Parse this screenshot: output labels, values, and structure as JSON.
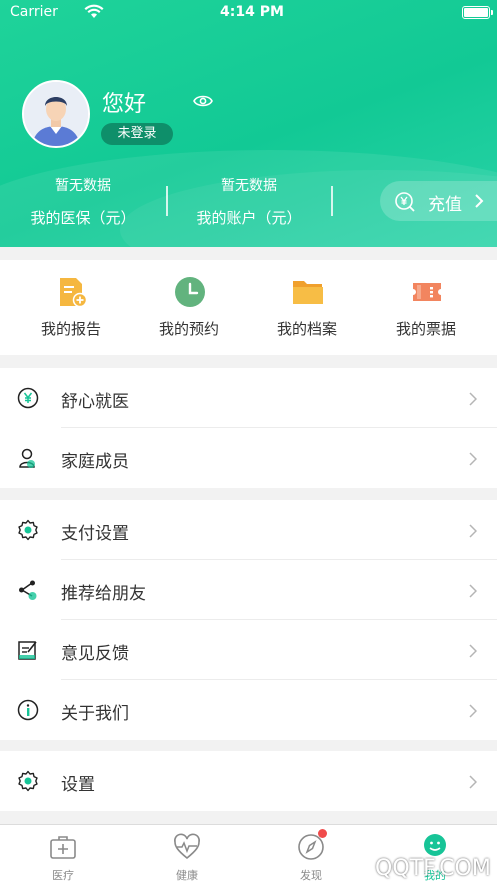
{
  "status_bar": {
    "carrier": "Carrier",
    "time": "4:14 PM"
  },
  "profile": {
    "greeting": "您好",
    "login_status": "未登录"
  },
  "stats": [
    {
      "value": "暂无数据",
      "label": "我的医保（元）"
    },
    {
      "value": "暂无数据",
      "label": "我的账户（元）"
    }
  ],
  "recharge": {
    "label": "充值"
  },
  "quick_actions": [
    {
      "label": "我的报告",
      "icon": "report-icon"
    },
    {
      "label": "我的预约",
      "icon": "clock-icon"
    },
    {
      "label": "我的档案",
      "icon": "folder-icon"
    },
    {
      "label": "我的票据",
      "icon": "ticket-icon"
    }
  ],
  "menu_group_1": [
    {
      "label": "舒心就医",
      "icon": "yen-circle-icon"
    },
    {
      "label": "家庭成员",
      "icon": "family-member-icon"
    }
  ],
  "menu_group_2": [
    {
      "label": "支付设置",
      "icon": "gear-icon"
    },
    {
      "label": "推荐给朋友",
      "icon": "share-icon"
    },
    {
      "label": "意见反馈",
      "icon": "feedback-icon"
    },
    {
      "label": "关于我们",
      "icon": "info-icon"
    }
  ],
  "menu_group_3": [
    {
      "label": "设置",
      "icon": "gear-icon"
    }
  ],
  "tabbar": [
    {
      "label": "医疗",
      "icon": "medical-kit-icon"
    },
    {
      "label": "健康",
      "icon": "heart-pulse-icon"
    },
    {
      "label": "发现",
      "icon": "compass-icon"
    },
    {
      "label": "我的",
      "icon": "profile-icon"
    }
  ],
  "watermark": "QQTF.COM",
  "colors": {
    "primary": "#17c497",
    "accent_orange": "#f5b740",
    "badge_green": "#0e8f6a",
    "notification_red": "#f04b4b"
  }
}
